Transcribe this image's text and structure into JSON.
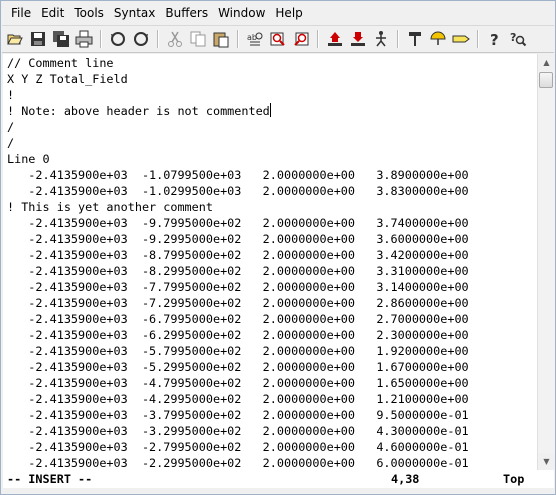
{
  "menu": [
    "File",
    "Edit",
    "Tools",
    "Syntax",
    "Buffers",
    "Window",
    "Help"
  ],
  "toolbar": [
    "open-icon",
    "save-icon",
    "save-all-icon",
    "print-icon",
    "undo-icon",
    "redo-icon",
    "cut-icon",
    "copy-icon",
    "paste-icon",
    "find-replace-icon",
    "find-next-icon",
    "find-prev-icon",
    "load-session-icon",
    "save-session-icon",
    "run-script-icon",
    "make-icon",
    "shell-icon",
    "ctags-icon",
    "help-icon",
    "find-help-icon"
  ],
  "editor": {
    "lines": [
      "// Comment line",
      "X Y Z Total_Field",
      "!",
      "! Note: above header is not commented",
      "/",
      "/",
      "Line 0",
      "   -2.4135900e+03  -1.0799500e+03   2.0000000e+00   3.8900000e+00",
      "   -2.4135900e+03  -1.0299500e+03   2.0000000e+00   3.8300000e+00",
      "! This is yet another comment",
      "   -2.4135900e+03  -9.7995000e+02   2.0000000e+00   3.7400000e+00",
      "   -2.4135900e+03  -9.2995000e+02   2.0000000e+00   3.6000000e+00",
      "   -2.4135900e+03  -8.7995000e+02   2.0000000e+00   3.4200000e+00",
      "   -2.4135900e+03  -8.2995000e+02   2.0000000e+00   3.3100000e+00",
      "   -2.4135900e+03  -7.7995000e+02   2.0000000e+00   3.1400000e+00",
      "   -2.4135900e+03  -7.2995000e+02   2.0000000e+00   2.8600000e+00",
      "   -2.4135900e+03  -6.7995000e+02   2.0000000e+00   2.7000000e+00",
      "   -2.4135900e+03  -6.2995000e+02   2.0000000e+00   2.3000000e+00",
      "   -2.4135900e+03  -5.7995000e+02   2.0000000e+00   1.9200000e+00",
      "   -2.4135900e+03  -5.2995000e+02   2.0000000e+00   1.6700000e+00",
      "   -2.4135900e+03  -4.7995000e+02   2.0000000e+00   1.6500000e+00",
      "   -2.4135900e+03  -4.2995000e+02   2.0000000e+00   1.2100000e+00",
      "   -2.4135900e+03  -3.7995000e+02   2.0000000e+00   9.5000000e-01",
      "   -2.4135900e+03  -3.2995000e+02   2.0000000e+00   4.3000000e-01",
      "   -2.4135900e+03  -2.7995000e+02   2.0000000e+00   4.6000000e-01",
      "   -2.4135900e+03  -2.2995000e+02   2.0000000e+00   6.0000000e-01"
    ],
    "cursor_line": 3
  },
  "status": {
    "mode": "-- INSERT --",
    "position": "4,38",
    "scroll": "Top"
  },
  "colors": {
    "editor_bg": "#ffffff",
    "chrome_bg": "#f0f0f0"
  }
}
